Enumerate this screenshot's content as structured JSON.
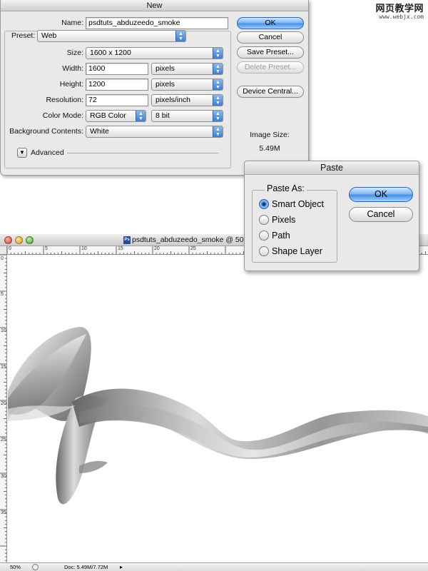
{
  "watermark": {
    "cn": "网页教学网",
    "en": "www.webjx.com"
  },
  "new_dialog": {
    "title": "New",
    "name_label": "Name:",
    "name_value": "psdtuts_abduzeedo_smoke",
    "preset_label": "Preset:",
    "preset_value": "Web",
    "size_label": "Size:",
    "size_value": "1600 x 1200",
    "width_label": "Width:",
    "width_value": "1600",
    "width_unit": "pixels",
    "height_label": "Height:",
    "height_value": "1200",
    "height_unit": "pixels",
    "resolution_label": "Resolution:",
    "resolution_value": "72",
    "resolution_unit": "pixels/inch",
    "color_mode_label": "Color Mode:",
    "color_mode_value": "RGB Color",
    "bit_depth_value": "8 bit",
    "background_label": "Background Contents:",
    "background_value": "White",
    "advanced_label": "Advanced",
    "buttons": {
      "ok": "OK",
      "cancel": "Cancel",
      "save_preset": "Save Preset...",
      "delete_preset": "Delete Preset...",
      "device_central": "Device Central..."
    },
    "image_size_label": "Image Size:",
    "image_size_value": "5.49M"
  },
  "paste_dialog": {
    "title": "Paste",
    "group_label": "Paste As:",
    "options": [
      "Smart Object",
      "Pixels",
      "Path",
      "Shape Layer"
    ],
    "selected_index": 0,
    "buttons": {
      "ok": "OK",
      "cancel": "Cancel"
    }
  },
  "document": {
    "title": "psdtuts_abduzeedo_smoke @ 50%",
    "icon_text": "Ps",
    "ruler_h_ticks": [
      "0",
      "5",
      "10",
      "15",
      "20",
      "25"
    ],
    "ruler_v_ticks": [
      "0",
      "5",
      "10",
      "15",
      "20",
      "25",
      "30",
      "35"
    ],
    "zoom": "50%",
    "doc_info": "Doc: 5.49M/7.72M"
  },
  "colors": {
    "accent": "#4c93e6",
    "smoke_dark": "#6e6e6e",
    "smoke_light": "#f4f4f4"
  }
}
